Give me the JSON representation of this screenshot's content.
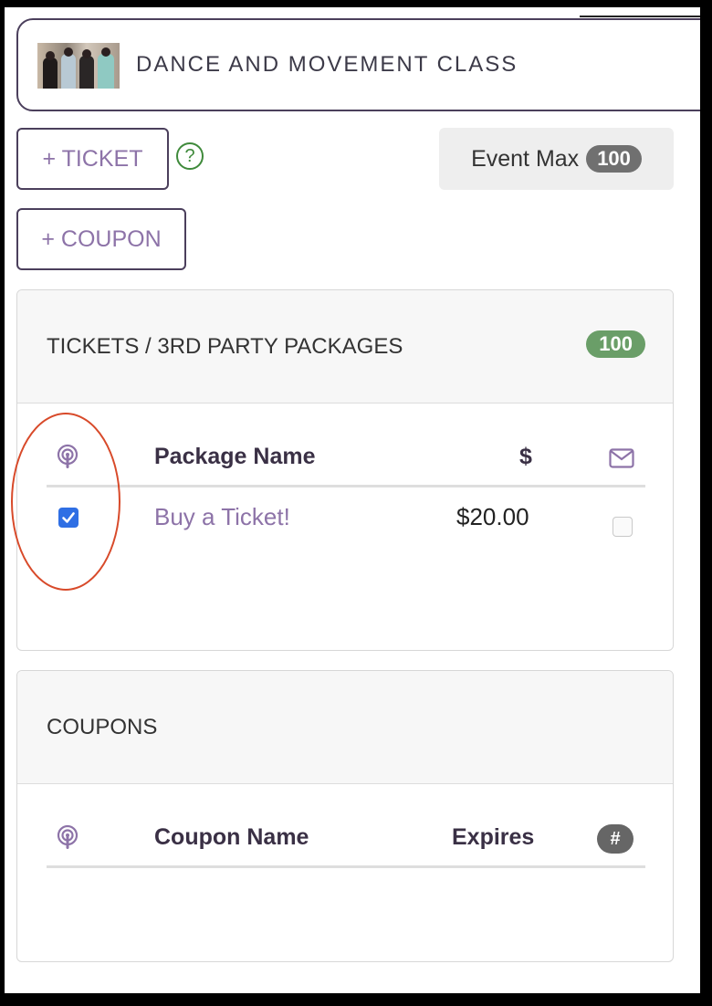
{
  "event": {
    "title": "DANCE AND MOVEMENT CLASS",
    "thumbnail_icon": "event-photo"
  },
  "actions": {
    "add_ticket_label": "+ TICKET",
    "add_coupon_label": "+ COUPON",
    "help_glyph": "?",
    "help_icon": "question-circle-icon"
  },
  "event_max": {
    "label": "Event Max",
    "value": "100"
  },
  "tickets_section": {
    "title": "TICKETS / 3RD PARTY PACKAGES",
    "count": "100",
    "columns": {
      "broadcast_icon": "broadcast-icon",
      "name": "Package Name",
      "price": "$",
      "email_icon": "envelope-icon"
    },
    "rows": [
      {
        "published": true,
        "name": "Buy a Ticket!",
        "price": "$20.00",
        "email": false
      }
    ]
  },
  "coupons_section": {
    "title": "COUPONS",
    "columns": {
      "broadcast_icon": "broadcast-icon",
      "name": "Coupon Name",
      "expires": "Expires",
      "count": "#"
    },
    "rows": []
  },
  "colors": {
    "accent_purple": "#8d73a8",
    "border_dark": "#4b3f5c",
    "success_green": "#6a9e68",
    "help_green": "#3f8a3b",
    "checkbox_blue": "#2f6fe4",
    "annotation_red": "#d84a2a"
  }
}
